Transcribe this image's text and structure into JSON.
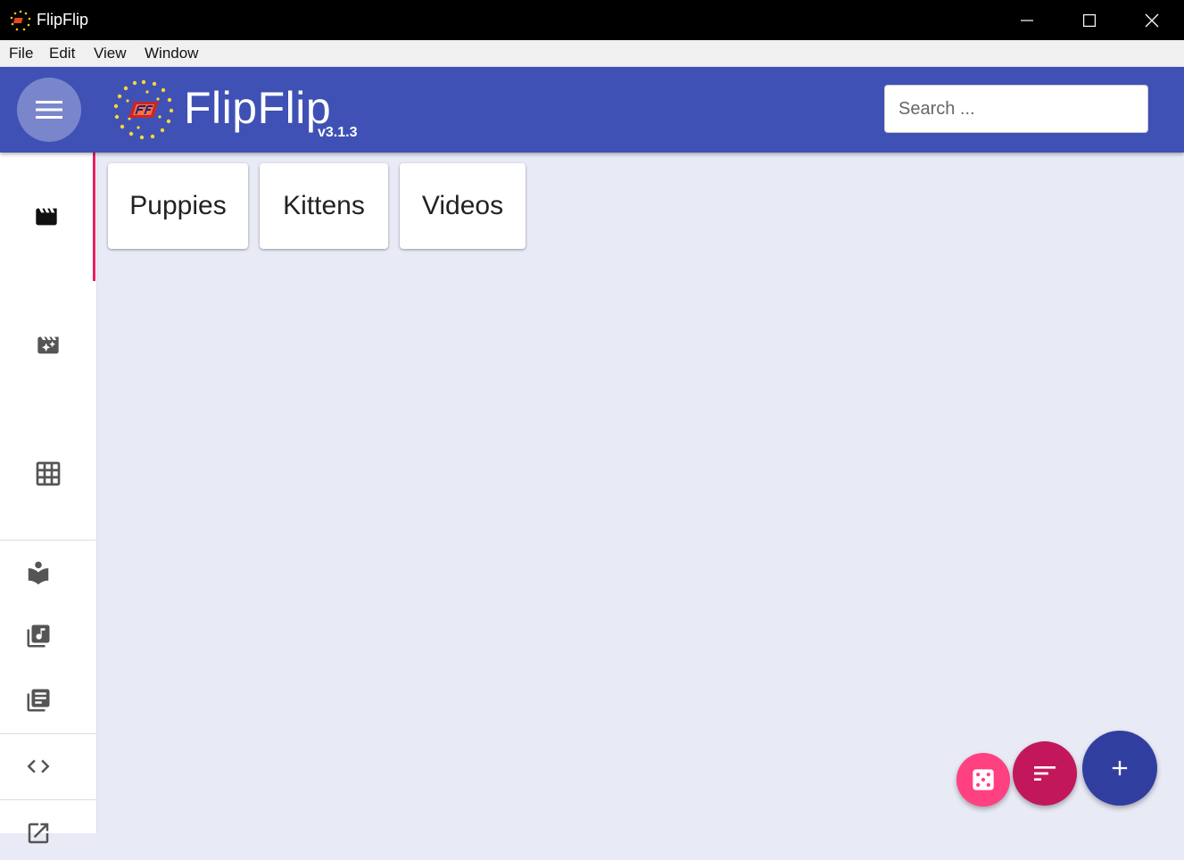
{
  "window": {
    "title": "FlipFlip"
  },
  "menubar": {
    "items": [
      "File",
      "Edit",
      "View",
      "Window"
    ]
  },
  "appbar": {
    "brand": "FlipFlip",
    "version": "v3.1.3",
    "search_placeholder": "Search ..."
  },
  "sidebar": {
    "main_items": [
      {
        "icon": "movie-icon",
        "active": true
      },
      {
        "icon": "movie-filter-icon",
        "active": false
      },
      {
        "icon": "grid-icon",
        "active": false
      }
    ],
    "secondary_items": [
      "library-icon",
      "audio-library-icon",
      "caption-library-icon"
    ],
    "tertiary_items": [
      "code-icon",
      "open-external-icon"
    ]
  },
  "scenes": [
    "Puppies",
    "Kittens",
    "Videos"
  ],
  "fabs": [
    {
      "name": "random-button",
      "icon": "dice-icon",
      "color": "#ff4081"
    },
    {
      "name": "sort-button",
      "icon": "sort-icon",
      "color": "#c2185b"
    },
    {
      "name": "add-button",
      "icon": "plus-icon",
      "color": "#303f9f"
    }
  ],
  "colors": {
    "primary": "#3f51b5",
    "accent": "#e91e63",
    "background": "#e8eaf6"
  }
}
